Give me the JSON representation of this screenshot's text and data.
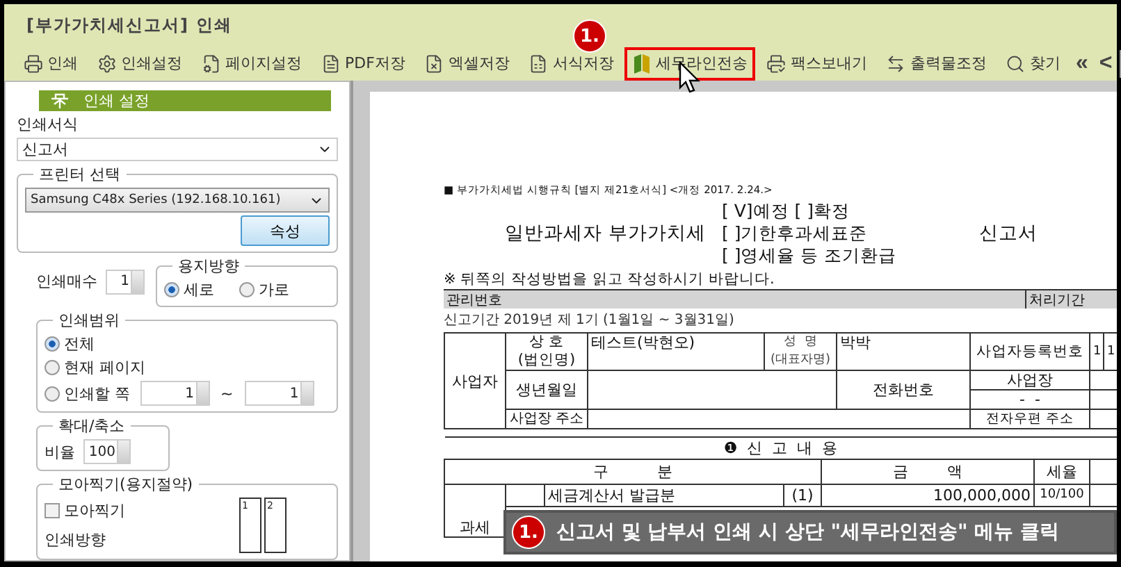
{
  "window": {
    "title": "[부가가치세신고서] 인쇄"
  },
  "toolbar": {
    "items": [
      {
        "label": "인쇄",
        "highlighted": false
      },
      {
        "label": "인쇄설정",
        "highlighted": false
      },
      {
        "label": "페이지설정",
        "highlighted": false
      },
      {
        "label": "PDF저장",
        "highlighted": false
      },
      {
        "label": "엑셀저장",
        "highlighted": false
      },
      {
        "label": "서식저장",
        "highlighted": false
      },
      {
        "label": "세무라인전송",
        "highlighted": true
      },
      {
        "label": "팩스보내기",
        "highlighted": false
      },
      {
        "label": "출력물조정",
        "highlighted": false
      },
      {
        "label": "찾기",
        "highlighted": false
      }
    ],
    "nav": [
      "«",
      "<"
    ],
    "step_badge": "1."
  },
  "sidebar": {
    "header": "인쇄 설정",
    "print_form": {
      "label": "인쇄서식",
      "value": "신고서"
    },
    "printer": {
      "legend": "프린터 선택",
      "value": "Samsung C48x Series (192.168.10.161)",
      "button": "속성"
    },
    "copies": {
      "label": "인쇄매수",
      "value": "1"
    },
    "orientation": {
      "legend": "용지방향",
      "options": [
        {
          "label": "세로",
          "selected": true
        },
        {
          "label": "가로",
          "selected": false
        }
      ]
    },
    "range": {
      "legend": "인쇄범위",
      "options": [
        {
          "label": "전체",
          "selected": true
        },
        {
          "label": "현재 페이지",
          "selected": false
        },
        {
          "label": "인쇄할 쪽",
          "selected": false
        }
      ],
      "from": "1",
      "separator": "~",
      "to": "1"
    },
    "zoom": {
      "legend": "확대/축소",
      "label": "비율",
      "value": "100"
    },
    "nup": {
      "legend": "모아찍기(용지절약)",
      "checkbox": {
        "label": "모아찍기",
        "checked": false
      },
      "direction_label": "인쇄방향",
      "pages": [
        "1",
        "2"
      ]
    }
  },
  "document": {
    "form_note": "■ 부가가치세법 시행규칙 [별지 제21호서식] <개정 2017. 2.24.>",
    "title": "일반과세자 부가가치세",
    "options": [
      "[ V]예정 [   ]확정",
      "[   ]기한후과세표준",
      "[   ]영세율 등 조기환급"
    ],
    "title_suffix": "신고서",
    "instruction": "※ 뒤쪽의 작성방법을 읽고 작성하시기 바랍니다.",
    "management_label": "관리번호",
    "processing_label": "처리기간",
    "period": "신고기간 2019년  제 1기 (1월1일 ~ 3월31일)",
    "business": {
      "section": "사업자",
      "name_label": "상 호\n(법인명)",
      "name": "테스트(박현오)",
      "rep_label": "성  명\n(대표자명)",
      "rep": "박박",
      "reg_label": "사업자등록번호",
      "reg_digits": [
        "1",
        "1"
      ],
      "birth_label": "생년월일",
      "phone_label": "전화번호",
      "site_label": "사업장",
      "site_phone": "-  -",
      "address_label": "사업장 주소",
      "email_label": "전자우편 주소"
    },
    "report": {
      "heading": "신  고  내  용",
      "heading_mark": "❶",
      "columns": [
        "구          분",
        "금        액",
        "세율"
      ],
      "rows": [
        {
          "group": "과세",
          "item": "세금계산서 발급분",
          "code": "(1)",
          "amount": "100,000,000",
          "rate": "10/100"
        }
      ]
    }
  },
  "callout": {
    "badge": "1.",
    "text": "신고서 및 납부서 인쇄 시 상단 \"세무라인전송\" 메뉴 클릭"
  }
}
